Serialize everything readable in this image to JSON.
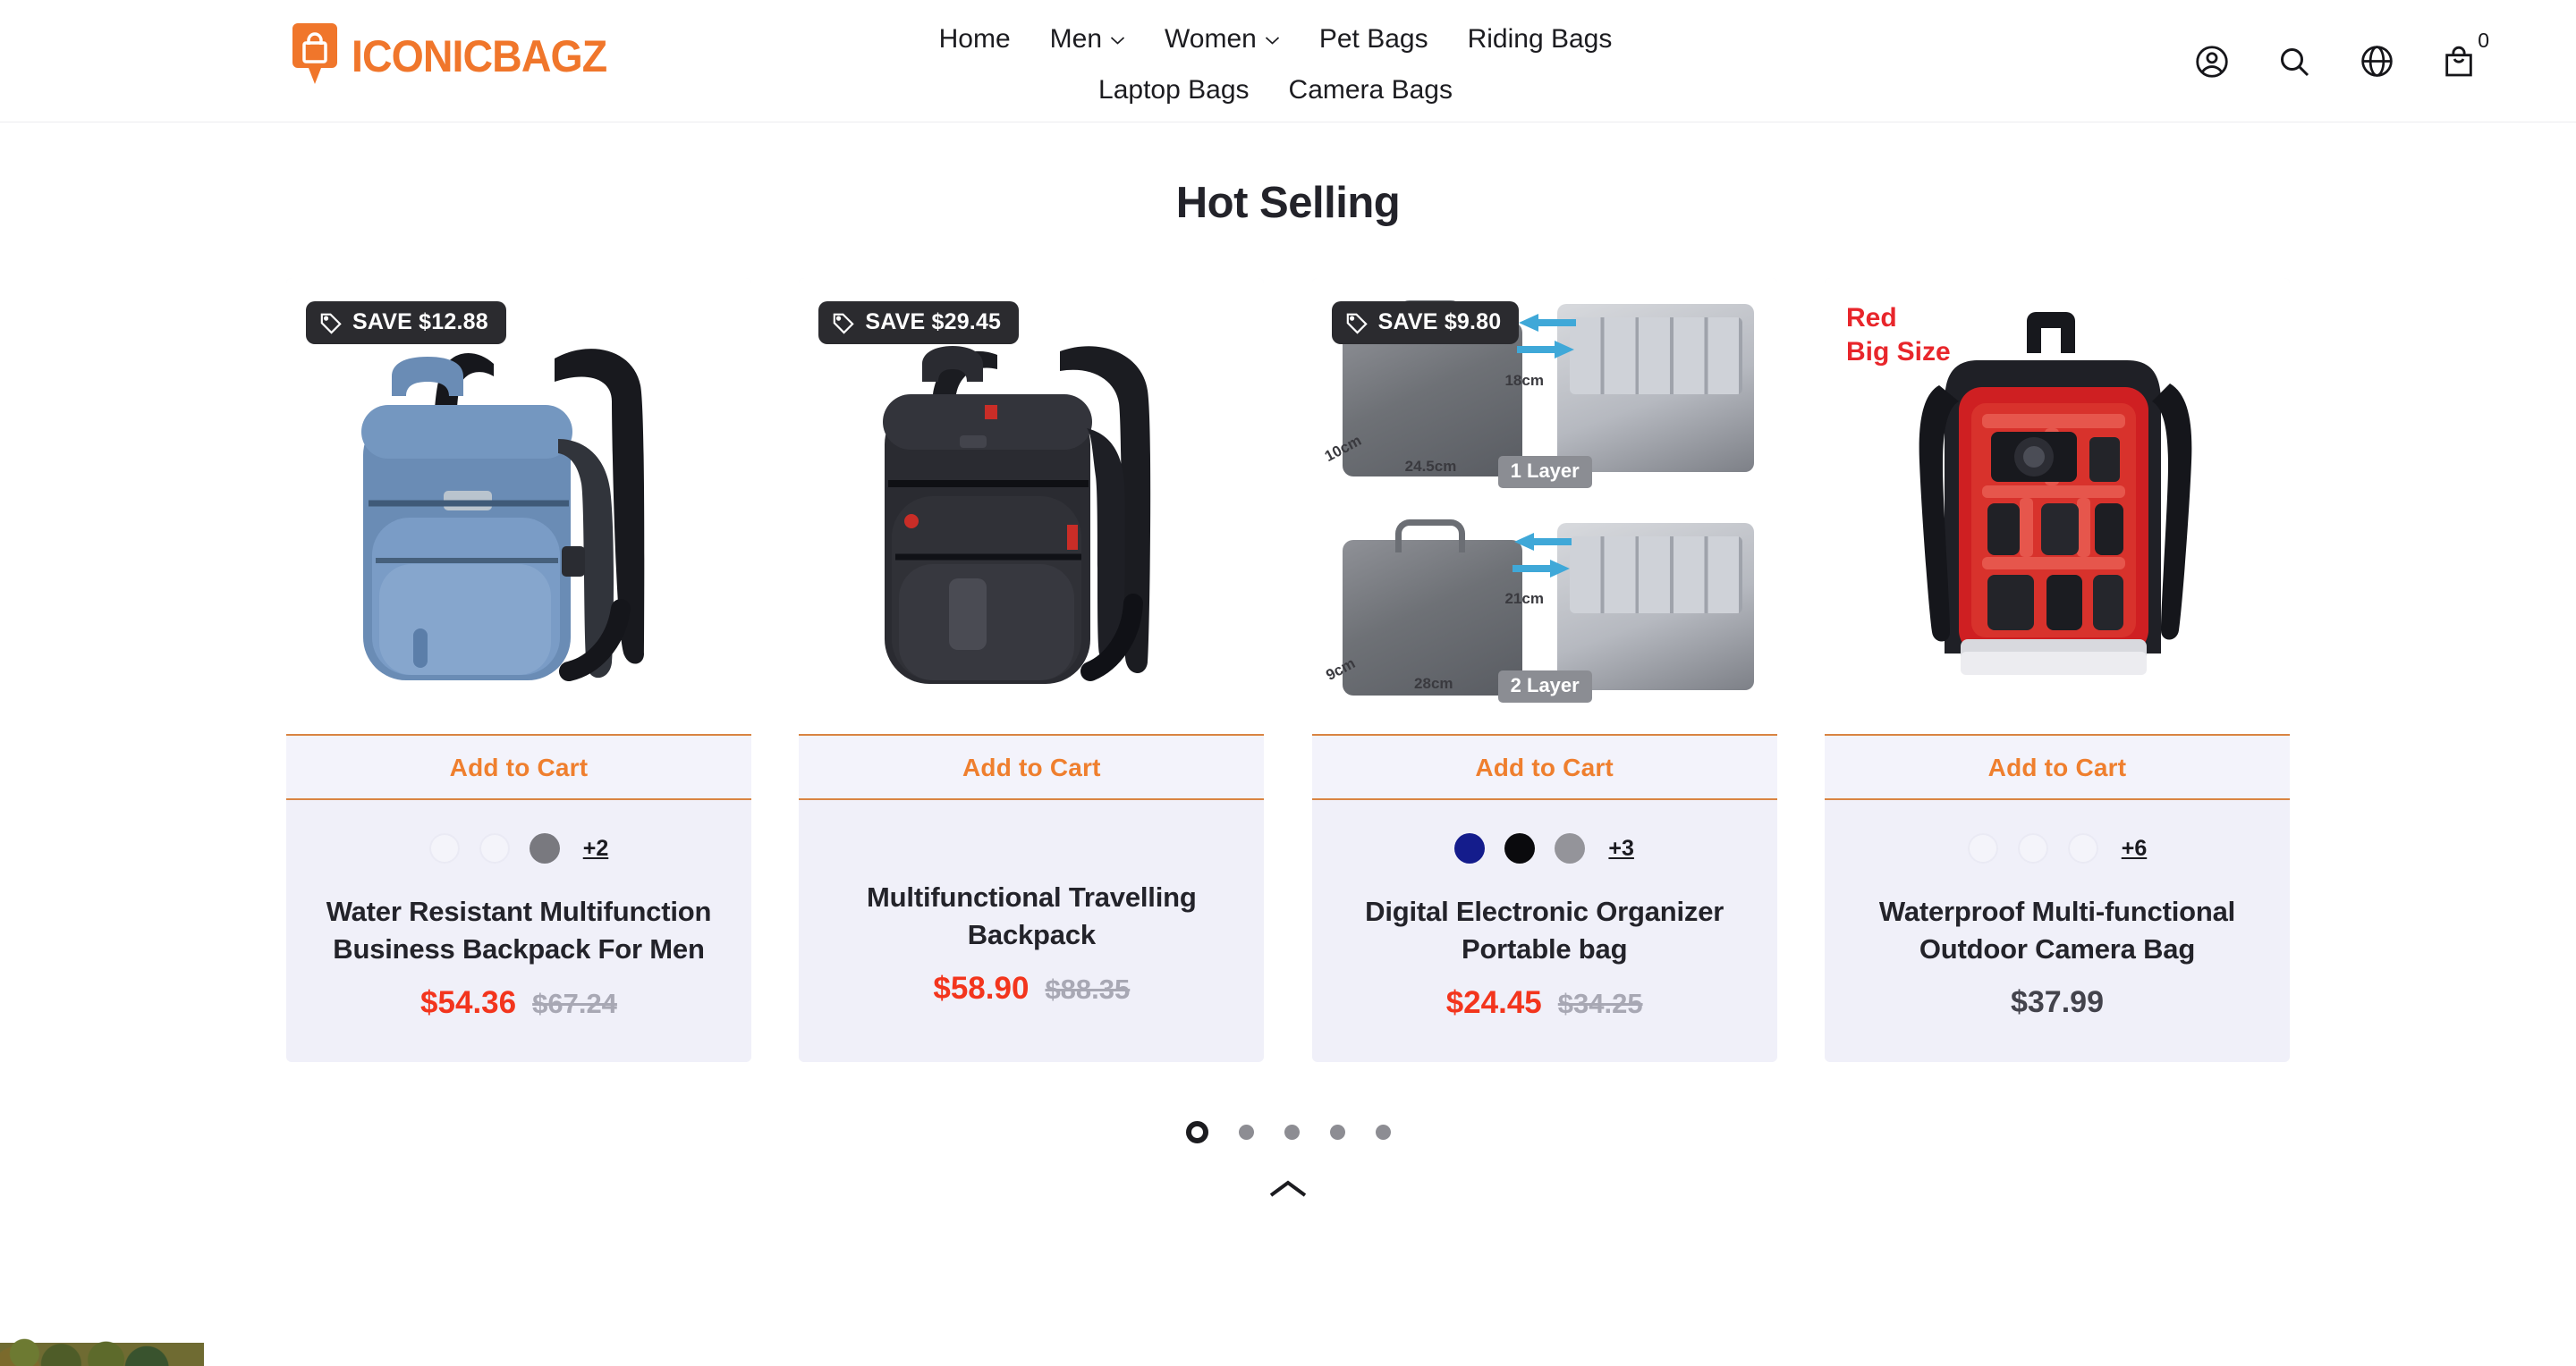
{
  "header": {
    "brand_name": "ICONICBAGZ",
    "brand_icon": "shopping-bag-pin-icon",
    "nav_row1": [
      {
        "label": "Home",
        "has_dropdown": false
      },
      {
        "label": "Men",
        "has_dropdown": true
      },
      {
        "label": "Women",
        "has_dropdown": true
      },
      {
        "label": "Pet Bags",
        "has_dropdown": false
      },
      {
        "label": "Riding Bags",
        "has_dropdown": false
      }
    ],
    "nav_row2": [
      {
        "label": "Laptop Bags",
        "has_dropdown": false
      },
      {
        "label": "Camera Bags",
        "has_dropdown": false
      }
    ],
    "actions": {
      "account_icon": "user-circle-icon",
      "search_icon": "search-icon",
      "language_icon": "globe-icon",
      "cart_icon": "shopping-bag-icon",
      "cart_count": "0"
    }
  },
  "section": {
    "title": "Hot Selling"
  },
  "products": [
    {
      "badge": "SAVE $12.88",
      "badge_icon": "price-tag-icon",
      "cta": "Add to Cart",
      "title": "Water Resistant Multifunction Business Backpack For Men",
      "price": "$54.36",
      "compare_at": "$67.24",
      "on_sale": true,
      "swatches": [
        "#f4f4fa",
        "#f4f4fa",
        "#79797f"
      ],
      "more_swatches": "+2"
    },
    {
      "badge": "SAVE $29.45",
      "badge_icon": "price-tag-icon",
      "cta": "Add to Cart",
      "title": "Multifunctional Travelling Backpack",
      "price": "$58.90",
      "compare_at": "$88.35",
      "on_sale": true,
      "swatches": [],
      "more_swatches": ""
    },
    {
      "badge": "SAVE $9.80",
      "badge_icon": "price-tag-icon",
      "cta": "Add to Cart",
      "title": "Digital Electronic Organizer Portable bag",
      "price": "$24.45",
      "compare_at": "$34.25",
      "on_sale": true,
      "swatches": [
        "#141c8c",
        "#0a0a0d",
        "#94949a"
      ],
      "more_swatches": "+3",
      "image_labels": {
        "layer1": "1 Layer",
        "layer2": "2 Layer",
        "dims_top": [
          "18cm",
          "10cm",
          "24.5cm"
        ],
        "dims_bottom": [
          "21cm",
          "9cm",
          "28cm"
        ]
      }
    },
    {
      "badge": "",
      "badge_icon": "",
      "cta": "Add to Cart",
      "title": "Waterproof Multi-functional Outdoor Camera Bag",
      "price": "$37.99",
      "compare_at": "",
      "on_sale": false,
      "swatches": [
        "#f4f4fa",
        "#f4f4fa",
        "#f4f4fa"
      ],
      "more_swatches": "+6",
      "image_labels": {
        "line1": "Red",
        "line2": "Big Size"
      }
    }
  ],
  "carousel": {
    "dots": 5,
    "active_index": 0
  },
  "scroll_top_icon": "chevron-up-icon",
  "colors": {
    "brand_orange": "#f0762b",
    "cta_orange": "#ef7f2e",
    "sale_red": "#f3351d",
    "card_bg": "#f0f0f9",
    "badge_bg": "#2b2b2f",
    "img_label_red": "#e8262b"
  }
}
